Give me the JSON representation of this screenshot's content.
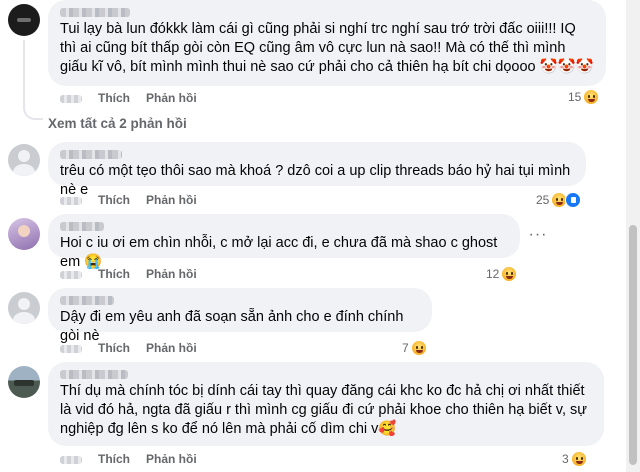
{
  "comments": [
    {
      "text": "Tui lạy bà lun đókkk làm cái gì cũng phải si nghí trc nghí sau trớ trời đấc oiii!!! IQ thì ai cũng bít thấp gòi còn EQ cũng âm vô cực lun nà sao!! Mà có thế thì mình giấu kĩ vô, bít mình mình thui nè sao cứ phải cho cả thiên hạ bít chi dọooo 🤡🤡🤡",
      "like_label": "Thích",
      "reply_label": "Phản hồi",
      "reaction_count": "15"
    },
    {
      "text": "trêu có một tẹo thôi sao mà khoá ? dzô coi a up clip threads báo hỷ hai tụi mình nè e",
      "like_label": "Thích",
      "reply_label": "Phản hồi",
      "reaction_count": "25"
    },
    {
      "text": "Hoi c iu ơi em chìn nhỗi, c mở lại acc đi, e chưa đã mà shao c ghost em 😭",
      "like_label": "Thích",
      "reply_label": "Phản hồi",
      "reaction_count": "12"
    },
    {
      "text": "Dậy đi em yêu anh đã soạn sẵn ảnh cho e đính chính gòi nè",
      "like_label": "Thích",
      "reply_label": "Phản hồi",
      "reaction_count": "7"
    },
    {
      "text": "Thí dụ mà chính tóc bị dính cái tay thì quay đăng cái khc ko đc hả chị ơi nhất thiết là vid đó hả, ngta đã giấu r thì mình cg giấu đi cứ phải khoe cho thiên hạ biết v, sự nghiệp đg lên s ko để nó lên mà phải cố dìm chi v🥰",
      "like_label": "Thích",
      "reply_label": "Phản hồi",
      "reaction_count": "3"
    }
  ],
  "see_all_replies": "Xem tất cả 2 phản hồi",
  "icons": {
    "reaction": "haha-emoji-icon",
    "like": "like-reaction-icon",
    "more": "more-options-icon"
  },
  "colors": {
    "bubble": "#f0f2f5",
    "secondary_text": "#65676b",
    "like_blue": "#1877f2"
  }
}
